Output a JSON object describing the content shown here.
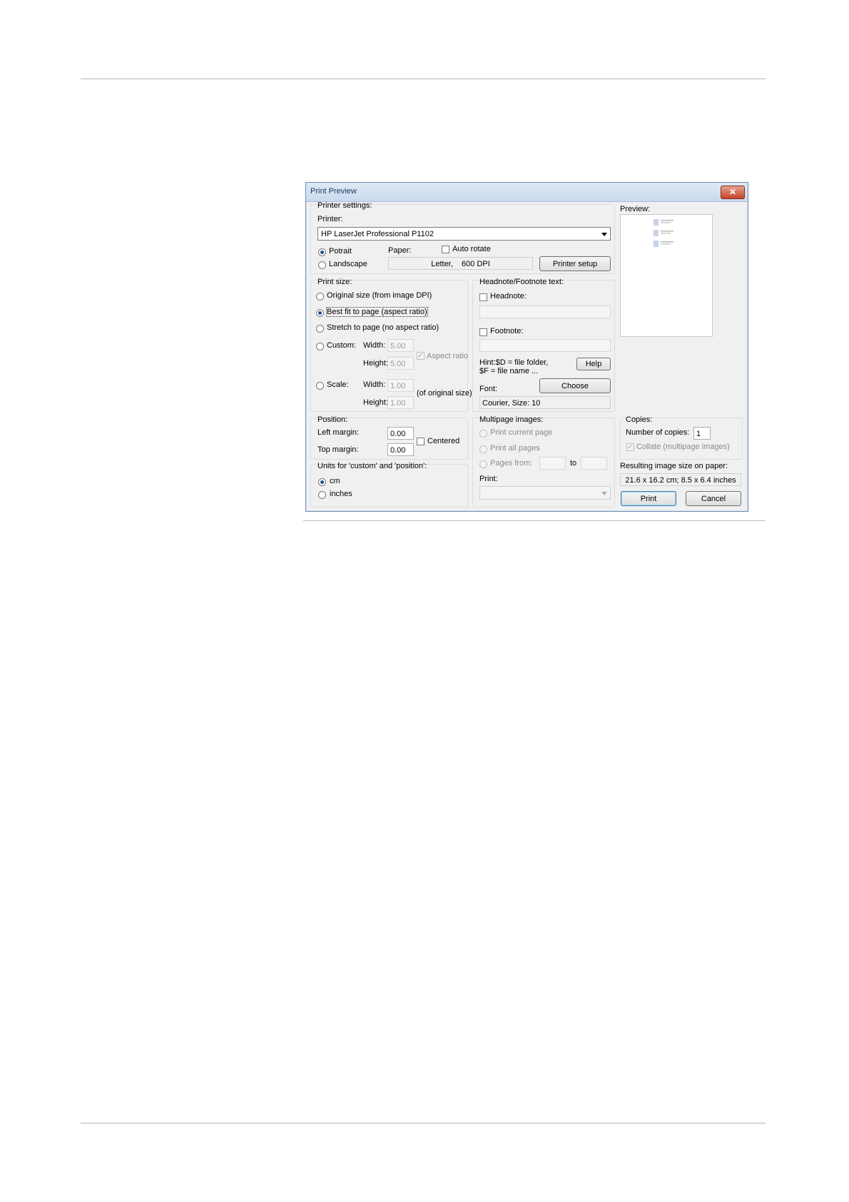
{
  "dialog": {
    "title": "Print Preview",
    "close_icon": "close-icon"
  },
  "printer_settings": {
    "group_label": "Printer settings:",
    "printer_label": "Printer:",
    "printer_value": "HP LaserJet Professional P1102",
    "portrait_label": "Potrait",
    "landscape_label": "Landscape",
    "orientation_selected": "portrait",
    "paper_label": "Paper:",
    "paper_value": "Letter,    600 DPI",
    "auto_rotate_label": "Auto rotate",
    "auto_rotate_checked": false,
    "printer_setup_label": "Printer setup"
  },
  "print_size": {
    "group_label": "Print size:",
    "original_label": "Original size (from image DPI)",
    "best_fit_label": "Best fit to page (aspect ratio)",
    "stretch_label": "Stretch to page (no aspect ratio)",
    "custom_label": "Custom:",
    "scale_label": "Scale:",
    "selected": "best_fit",
    "width_label": "Width:",
    "height_label": "Height:",
    "custom_width": "5.00",
    "custom_height": "5.00",
    "aspect_ratio_label": "Aspect ratio",
    "scale_width": "1.00",
    "scale_height": "1.00",
    "of_original_label": "(of original size)"
  },
  "headnote": {
    "group_label": "Headnote/Footnote text:",
    "headnote_label": "Headnote:",
    "headnote_value": "",
    "footnote_label": "Footnote:",
    "footnote_value": "",
    "hint_line1": "Hint:$D = file folder,",
    "hint_line2": "$F = file name ...",
    "help_label": "Help",
    "font_label": "Font:",
    "choose_label": "Choose",
    "font_value": "Courier, Size: 10"
  },
  "preview": {
    "label": "Preview:"
  },
  "position": {
    "group_label": "Position:",
    "left_margin_label": "Left margin:",
    "left_margin_value": "0.00",
    "top_margin_label": "Top margin:",
    "top_margin_value": "0.00",
    "centered_label": "Centered"
  },
  "units": {
    "group_label": "Units for 'custom' and 'position':",
    "cm_label": "cm",
    "inches_label": "inches",
    "selected": "cm"
  },
  "multipage": {
    "group_label": "Multipage images:",
    "current_label": "Print current page",
    "all_label": "Print all pages",
    "from_label": "Pages from:",
    "to_label": "to",
    "from_value": "",
    "to_value": "",
    "print_label": "Print:",
    "print_value": ""
  },
  "copies": {
    "group_label": "Copies:",
    "number_label": "Number of copies:",
    "number_value": "1",
    "collate_label": "Collate (multipage images)"
  },
  "result": {
    "label": "Resulting image size on paper:",
    "value": "21.6 x 16.2 cm; 8.5 x 6.4 inches"
  },
  "buttons": {
    "print_label": "Print",
    "cancel_label": "Cancel"
  }
}
